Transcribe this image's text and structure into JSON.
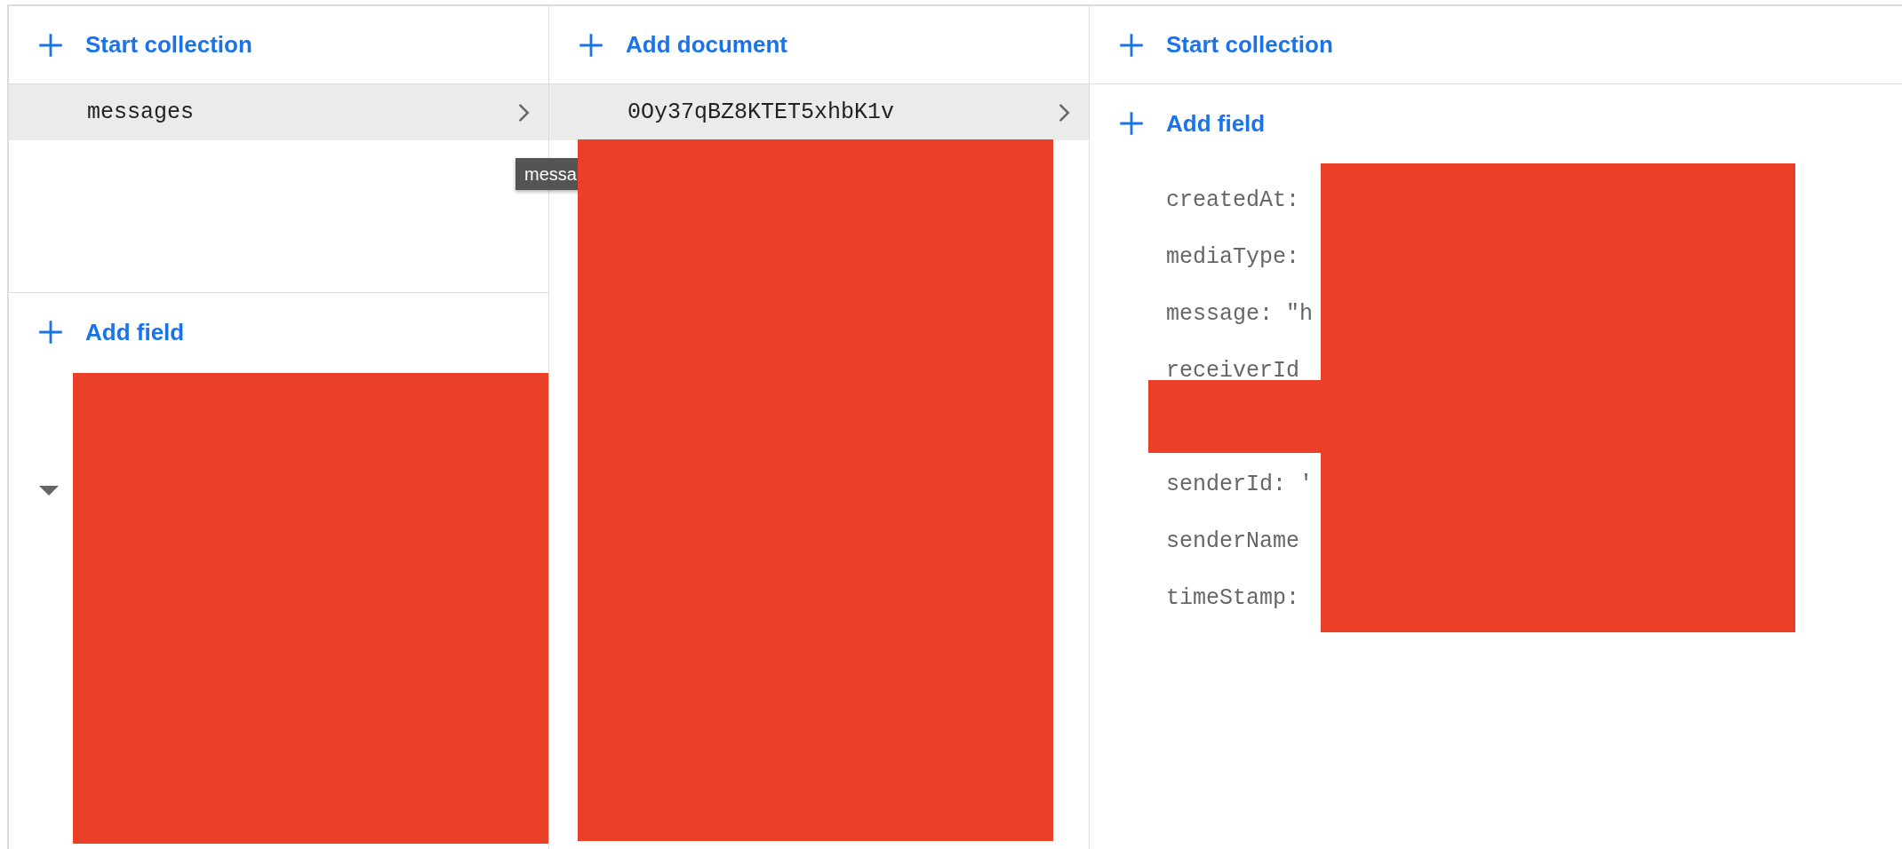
{
  "collections_panel": {
    "action": "Start collection",
    "items": [
      {
        "label": "messages",
        "selected": true
      }
    ],
    "add_field": "Add field",
    "tooltip": "messa"
  },
  "documents_panel": {
    "action": "Add document",
    "items": [
      {
        "label": "0Oy37qBZ8KTET5xhbK1v",
        "selected": true
      }
    ]
  },
  "document_panel": {
    "action": "Start collection",
    "add_field": "Add field",
    "fields": [
      {
        "text": "createdAt:"
      },
      {
        "text": "mediaType:"
      },
      {
        "text": "message: \"h"
      },
      {
        "text": "receiverId"
      },
      {
        "text": "senderId: '"
      },
      {
        "text": "senderName"
      },
      {
        "text": "timeStamp:"
      }
    ]
  }
}
